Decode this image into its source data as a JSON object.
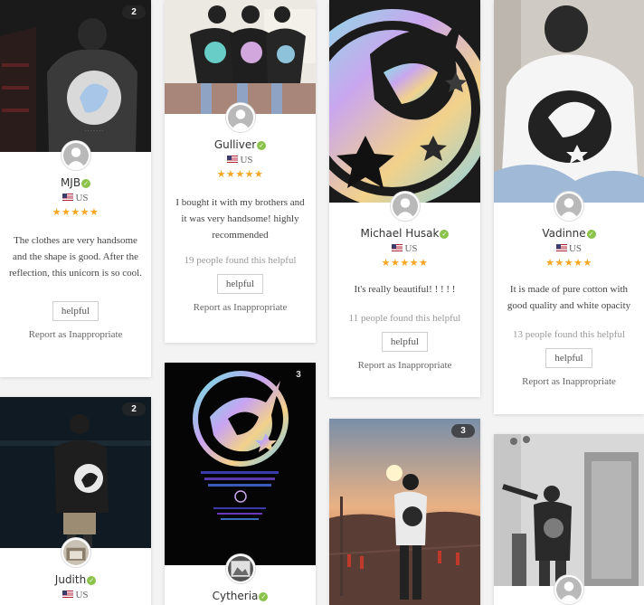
{
  "reviews": [
    {
      "name": "MJB",
      "country": "US",
      "stars": "★★★★★",
      "photo_count": "2",
      "text": "The clothes are very handsome and the shape is good. After the reflection, this unicorn is so cool.",
      "helpful_count": "",
      "helpful_label": "helpful",
      "report_label": "Report as Inappropriate"
    },
    {
      "name": "Gulliver",
      "country": "US",
      "stars": "★★★★★",
      "photo_count": "",
      "text": "I bought it with my brothers and it was very handsome! highly recommended",
      "helpful_count": "19 people found this helpful",
      "helpful_label": "helpful",
      "report_label": "Report as Inappropriate"
    },
    {
      "name": "Michael Husak",
      "country": "US",
      "stars": "★★★★★",
      "photo_count": "",
      "text": "It's really beautiful! ! ! ! !",
      "helpful_count": "11 people found this helpful",
      "helpful_label": "helpful",
      "report_label": "Report as Inappropriate"
    },
    {
      "name": "Vadinne",
      "country": "US",
      "stars": "★★★★★",
      "photo_count": "",
      "text": "It is made of pure cotton with good quality and white opacity",
      "helpful_count": "13 people found this helpful",
      "helpful_label": "helpful",
      "report_label": "Report as Inappropriate"
    },
    {
      "name": "Judith",
      "country": "US",
      "photo_count": "2"
    },
    {
      "name": "Cytheria",
      "photo_count": "3"
    },
    {
      "photo_count": "3"
    },
    {}
  ],
  "colors": {
    "star": "#f5a623",
    "verified": "#8bc34a",
    "background": "#f3f3f3"
  },
  "icons": {
    "verified": "check-circle-icon",
    "avatar": "user-icon",
    "flag": "us-flag-icon"
  }
}
